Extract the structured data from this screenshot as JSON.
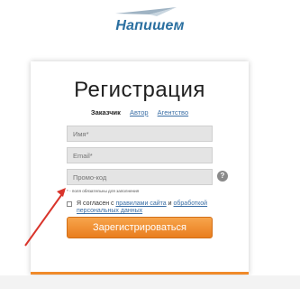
{
  "logo": {
    "text": "Напишем",
    "icon": "paper-plane-icon"
  },
  "form": {
    "title": "Регистрация",
    "tabs": [
      {
        "label": "Заказчик",
        "active": true
      },
      {
        "label": "Автор",
        "active": false
      },
      {
        "label": "Агентство",
        "active": false
      }
    ],
    "fields": {
      "name_placeholder": "Имя*",
      "email_placeholder": "Email*",
      "promo_placeholder": "Промо-код"
    },
    "help_icon": "?",
    "required_note": "* - поля обязательны для заполнения",
    "agree": {
      "prefix": "Я согласен с ",
      "site_rules_link": "правилами сайта",
      "and": " и ",
      "data_processing_link": "обработкой персональных данных"
    },
    "submit_label": "Зарегистрироваться"
  },
  "colors": {
    "accent": "#f08a2a",
    "link": "#3a6ea5",
    "brand": "#2a6fa0",
    "annotation_arrow": "#d9342b"
  }
}
